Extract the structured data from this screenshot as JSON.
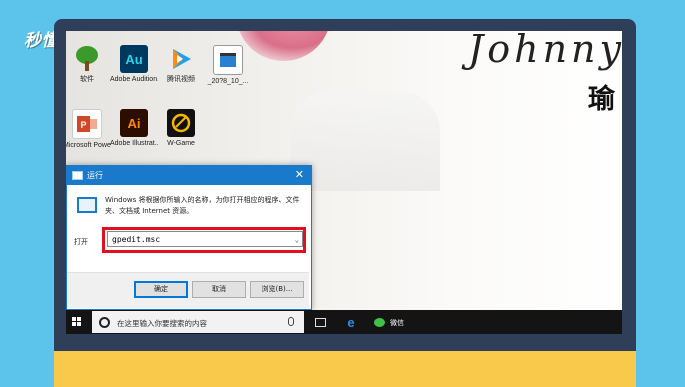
{
  "watermark": "秒懂视频",
  "wallpaper": {
    "name_text": "Johnny",
    "chinese_char": "瑜"
  },
  "desktop_icons": [
    {
      "label": "软件",
      "icon": "tree-icon"
    },
    {
      "label": "Adobe Audition...",
      "icon": "adobe-audition-icon"
    },
    {
      "label": "腾讯视频",
      "icon": "tencent-video-icon"
    },
    {
      "label": "_20?8_10_...",
      "icon": "video-file-icon"
    },
    {
      "label": "Microsoft PowerPoi...",
      "icon": "powerpoint-icon"
    },
    {
      "label": "Adobe Illustrat...",
      "icon": "illustrator-icon"
    },
    {
      "label": "W-Game",
      "icon": "w-game-icon"
    }
  ],
  "run_dialog": {
    "title": "运行",
    "close": "✕",
    "description": "Windows 将根据你所输入的名称，为你打开相应的程序、文件夹、文档或 Internet 资源。",
    "open_label": "打开",
    "input_value": "gpedit.msc",
    "ok_label": "确定",
    "cancel_label": "取消",
    "browse_label": "浏览(B)..."
  },
  "taskbar": {
    "search_placeholder": "在这里输入你要搜索的内容",
    "wechat_label": "微信"
  },
  "colors": {
    "accent": "#1979ca",
    "highlight": "#e0101f",
    "background": "#5cc4ea",
    "monitor_bottom": "#f8c94b"
  }
}
